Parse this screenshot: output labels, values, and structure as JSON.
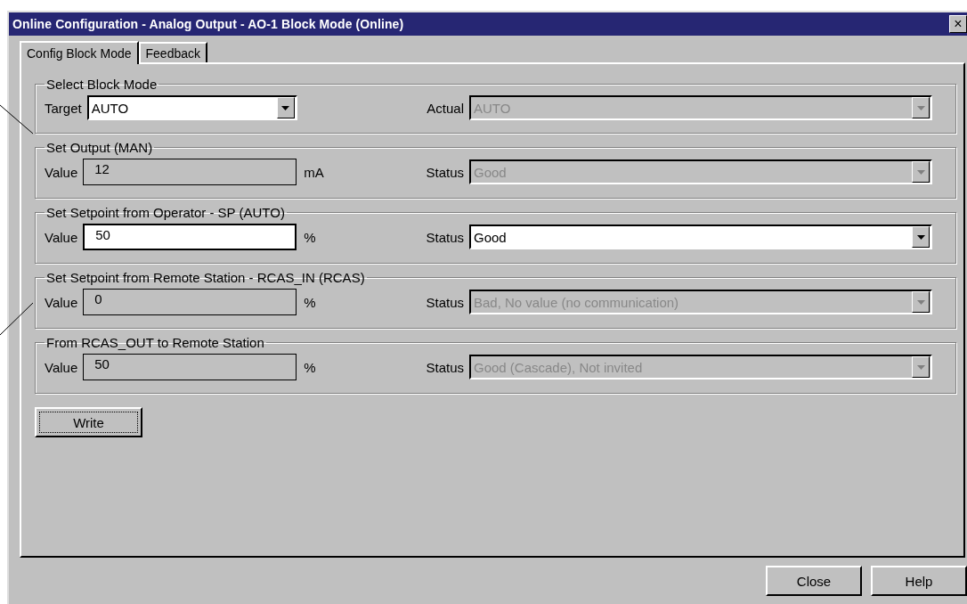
{
  "window": {
    "title": "Online Configuration - Analog Output - AO-1 Block Mode  (Online)",
    "close_button": "×"
  },
  "tabs": [
    {
      "label": "Config Block Mode",
      "selected": true
    },
    {
      "label": "Feedback",
      "selected": false
    }
  ],
  "groups": [
    {
      "title": "Select Block Mode",
      "left": {
        "kind": "dropdown",
        "label": "Target",
        "value": "AUTO",
        "disabled": false
      },
      "right": {
        "label": "Actual",
        "value": "AUTO",
        "disabled": true
      }
    },
    {
      "title": "Set Output (MAN)",
      "left": {
        "kind": "field",
        "label": "Value",
        "value": "12",
        "unit": "mA",
        "disabled": true
      },
      "right": {
        "label": "Status",
        "value": "Good",
        "disabled": true
      }
    },
    {
      "title": "Set Setpoint from Operator - SP (AUTO)",
      "left": {
        "kind": "field",
        "label": "Value",
        "value": "50",
        "unit": "%",
        "disabled": false
      },
      "right": {
        "label": "Status",
        "value": "Good",
        "disabled": false
      }
    },
    {
      "title": "Set Setpoint from Remote Station - RCAS_IN (RCAS)",
      "left": {
        "kind": "field",
        "label": "Value",
        "value": "0",
        "unit": "%",
        "disabled": true
      },
      "right": {
        "label": "Status",
        "value": "Bad, No value (no communication)",
        "disabled": true
      }
    },
    {
      "title": "From RCAS_OUT to Remote Station",
      "left": {
        "kind": "field",
        "label": "Value",
        "value": "50",
        "unit": "%",
        "disabled": true
      },
      "right": {
        "label": "Status",
        "value": "Good (Cascade), Not invited",
        "disabled": true
      }
    }
  ],
  "write_button": "Write",
  "buttons": [
    "Close",
    "Help"
  ]
}
